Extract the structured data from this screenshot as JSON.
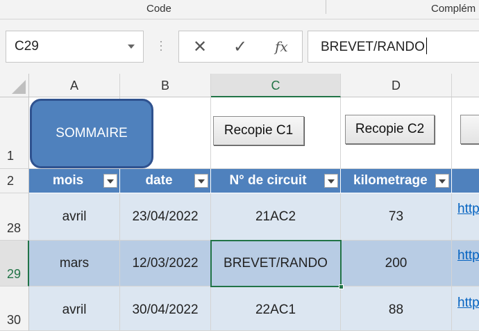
{
  "ribbon": {
    "group_code": "Code",
    "group_complements": "Complém"
  },
  "formula_bar": {
    "name_box": "C29",
    "cancel_icon": "✕",
    "enter_icon": "✓",
    "fx_label": "fx",
    "content": "BREVET/RANDO"
  },
  "columns": [
    "A",
    "B",
    "C",
    "D"
  ],
  "selected_column": "C",
  "rows": {
    "r1": "1",
    "r2": "2",
    "r28": "28",
    "r29": "29",
    "r30": "30"
  },
  "shapes": {
    "sommaire": "SOMMAIRE",
    "recopie_c1": "Recopie C1",
    "recopie_c2": "Recopie C2"
  },
  "table": {
    "headers": [
      "mois",
      "date",
      "N° de circuit",
      "kilometrage"
    ],
    "data": [
      {
        "row": "28",
        "mois": "avril",
        "date": "23/04/2022",
        "circuit": "21AC2",
        "km": "73",
        "link": "http"
      },
      {
        "row": "29",
        "mois": "mars",
        "date": "12/03/2022",
        "circuit": "BREVET/RANDO",
        "km": "200",
        "link": "http"
      },
      {
        "row": "30",
        "mois": "avril",
        "date": "30/04/2022",
        "circuit": "22AC1",
        "km": "88",
        "link": "http"
      }
    ]
  },
  "colors": {
    "header_blue": "#4f81bd",
    "band_light": "#dce6f1",
    "band_dark": "#b8cce4",
    "excel_green": "#217346",
    "link_blue": "#0563c1"
  }
}
